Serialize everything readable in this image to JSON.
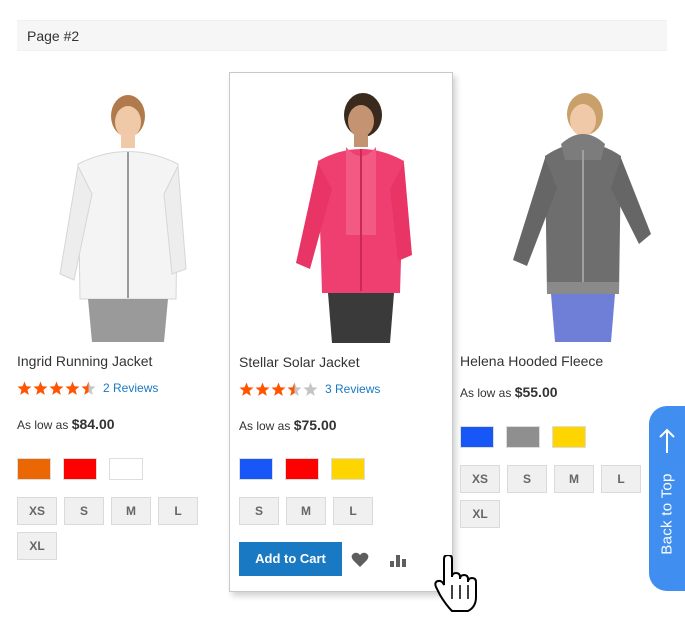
{
  "page_label": "Page #2",
  "products": [
    {
      "name": "Ingrid Running Jacket",
      "rating": 4.5,
      "reviews": "2 Reviews",
      "price_prefix": "As low as",
      "price": "$84.00",
      "colors": [
        "#eb6703",
        "#ff0000",
        "#ffffff"
      ],
      "sizes": [
        "XS",
        "S",
        "M",
        "L",
        "XL"
      ]
    },
    {
      "name": "Stellar Solar Jacket",
      "rating": 3.5,
      "reviews": "3 Reviews",
      "price_prefix": "As low as",
      "price": "$75.00",
      "colors": [
        "#1857f7",
        "#ff0000",
        "#ffd500"
      ],
      "sizes": [
        "S",
        "M",
        "L"
      ],
      "add_to_cart": "Add to Cart"
    },
    {
      "name": "Helena Hooded Fleece",
      "price_prefix": "As low as",
      "price": "$55.00",
      "colors": [
        "#1857f7",
        "#8f8f8f",
        "#ffd500"
      ],
      "sizes": [
        "XS",
        "S",
        "M",
        "L",
        "XL"
      ]
    }
  ],
  "back_to_top": "Back to Top",
  "colors": {
    "accent": "#1979c3",
    "star": "#ff5501",
    "back_to_top_bg": "#3f8ef0"
  }
}
